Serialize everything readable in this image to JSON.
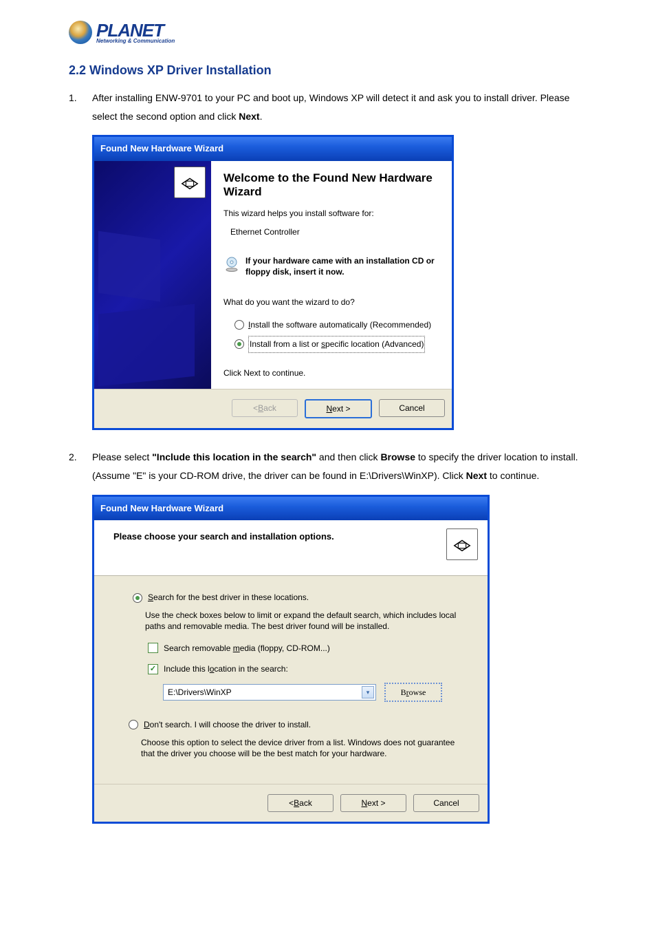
{
  "logo": {
    "brand": "PLANET",
    "tagline": "Networking & Communication"
  },
  "section_title": "2.2 Windows XP Driver Installation",
  "step1": {
    "number": "1.",
    "text_a": "After installing ENW-9701 to your PC and boot up, Windows XP will detect it and ask you to install driver. Please select the second option and click ",
    "bold_next": "Next",
    "dot": "."
  },
  "wiz1": {
    "title": "Found New Hardware Wizard",
    "welcome": "Welcome to the Found New Hardware Wizard",
    "helps": "This wizard helps you install software for:",
    "device": "Ethernet Controller",
    "cd_note": "If your hardware came with an installation CD or floppy disk, insert it now.",
    "question": "What do you want the wizard to do?",
    "opt1_a": "I",
    "opt1_b": "nstall the software automatically (Recommended)",
    "opt2_a": "Install from a list or ",
    "opt2_s": "s",
    "opt2_b": "pecific location (Advanced)",
    "continue": "Click Next to continue.",
    "btn_back_lt": "< ",
    "btn_back_b": "B",
    "btn_back_a": "ack",
    "btn_next_n": "N",
    "btn_next_a": "ext >",
    "btn_cancel": "Cancel"
  },
  "step2": {
    "number": "2.",
    "a": "Please select ",
    "bold1": "\"Include this location in the search\"",
    "b": " and then click ",
    "bold2": "Browse",
    "c": " to specify the driver location to install. (Assume \"E\" is your CD-ROM drive, the driver can be found in E:\\Drivers\\WinXP). Click ",
    "bold3": "Next",
    "d": " to continue."
  },
  "wiz2": {
    "title": "Found New Hardware Wizard",
    "heading": "Please choose your search and installation options.",
    "r1_s": "S",
    "r1_a": "earch for the best driver in these locations.",
    "desc1": "Use the check boxes below to limit or expand the default search, which includes local paths and removable media. The best driver found will be installed.",
    "chk1_a": "Search removable ",
    "chk1_m": "m",
    "chk1_b": "edia (floppy, CD-ROM...)",
    "chk2_a": "Include this l",
    "chk2_o": "o",
    "chk2_b": "cation in the search:",
    "path": "E:\\Drivers\\WinXP",
    "browse_r": "r",
    "browse_a": "B",
    "browse_b": "owse",
    "r2_d": "D",
    "r2_a": "on't search. I will choose the driver to install.",
    "desc2": "Choose this option to select the device driver from a list.  Windows does not guarantee that the driver you choose will be the best match for your hardware.",
    "btn_back_lt": "< ",
    "btn_back_b": "B",
    "btn_back_a": "ack",
    "btn_next_n": "N",
    "btn_next_a": "ext >",
    "btn_cancel": "Cancel"
  }
}
